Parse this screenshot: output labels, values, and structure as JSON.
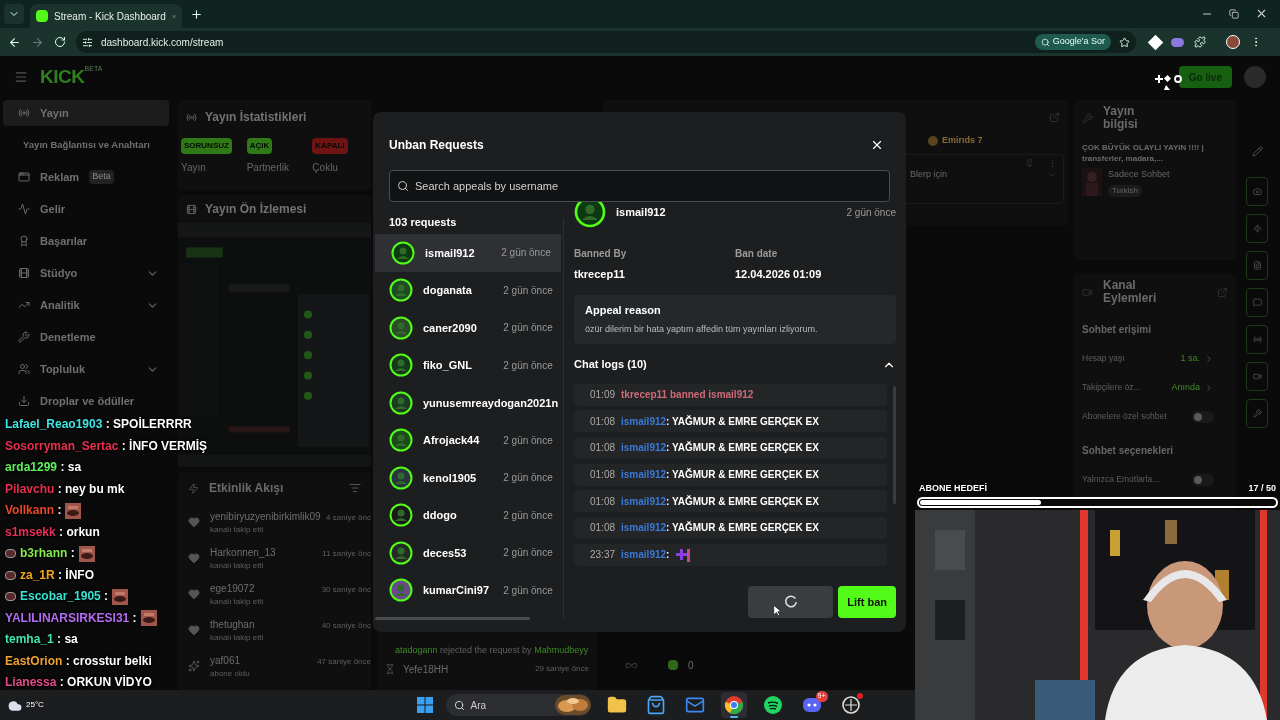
{
  "browser": {
    "tab_title": "Stream - Kick Dashboard",
    "url": "dashboard.kick.com/stream",
    "ask_google": "Google'a Sor"
  },
  "header": {
    "logo": "KICK",
    "logo_badge": "BETA",
    "go_live": "Go live"
  },
  "sidebar": [
    {
      "label": "Yayın",
      "kind": "item",
      "selected": true,
      "expandable": false
    },
    {
      "label": "Yayın Bağlantısı ve Anahtarı",
      "kind": "sub",
      "selected": false,
      "expandable": false
    },
    {
      "label": "Reklam",
      "badge": "Beta",
      "kind": "item",
      "selected": false,
      "expandable": false
    },
    {
      "label": "Gelir",
      "kind": "item",
      "selected": false,
      "expandable": false
    },
    {
      "label": "Başarılar",
      "kind": "item",
      "selected": false,
      "expandable": false
    },
    {
      "label": "Stüdyo",
      "kind": "item",
      "selected": false,
      "expandable": true
    },
    {
      "label": "Analitik",
      "kind": "item",
      "selected": false,
      "expandable": true
    },
    {
      "label": "Denetleme",
      "kind": "item",
      "selected": false,
      "expandable": false
    },
    {
      "label": "Topluluk",
      "kind": "item",
      "selected": false,
      "expandable": true
    },
    {
      "label": "Droplar ve ödüller",
      "kind": "item",
      "selected": false,
      "expandable": false
    }
  ],
  "stats": {
    "title": "Yayın İstatistikleri",
    "items": [
      {
        "status": "SORUNSUZ",
        "label": "Yayın",
        "color": "#2f7a16"
      },
      {
        "status": "AÇIK",
        "label": "Partnerlik",
        "color": "#2f7a16"
      },
      {
        "status": "KAPALI",
        "label": "Çoklu",
        "color": "#6e1414"
      }
    ]
  },
  "preview": {
    "title": "Yayın Ön İzlemesi"
  },
  "activity": {
    "title": "Etkinlik Akışı",
    "events": [
      {
        "kind": "follow",
        "user": "yenibiryuzyenibirkimlik09",
        "time": "4 saniye önc",
        "action": "kanalı takip etti"
      },
      {
        "kind": "follow",
        "user": "Harkonnen_13",
        "time": "11 saniye önc",
        "action": "kanalı takip etti"
      },
      {
        "kind": "follow",
        "user": "ege19072",
        "time": "30 saniye önc",
        "action": "kanalı takip etti"
      },
      {
        "kind": "follow",
        "user": "thetughan",
        "time": "40 saniye önc",
        "action": "kanalı takip etti"
      },
      {
        "kind": "subscribe",
        "user": "yaf061",
        "time": "47 saniye önce",
        "action": "abone oldu"
      }
    ]
  },
  "mod_log": [
    {
      "kind": "rejected",
      "actor": "atadogann",
      "text": "rejected the request by",
      "target": "Mahmudbeyy"
    },
    {
      "kind": "timeout",
      "user": "Yefe18HH",
      "time": "29 saniye önce"
    }
  ],
  "chat_panel": {
    "points": "Emirıds 7",
    "card": "Blerp için",
    "count": "0"
  },
  "stream_info": {
    "title": "Yayın bilgisi",
    "stream_title": "ÇOK BÜYÜK OLAYLI YAYIN !!!! | transferler, madara,...",
    "category": "Sadece Sohbet",
    "language": "Turkish"
  },
  "channel_actions": {
    "title": "Kanal Eylemleri",
    "sections": [
      {
        "heading": "Sohbet erişimi",
        "rows": [
          {
            "kind": "link",
            "label": "Hesap yaşı",
            "value": "1 sa."
          },
          {
            "kind": "link",
            "label": "Takipçilere öz...",
            "value": "Anında"
          },
          {
            "kind": "toggle",
            "label": "Abonelere özel sohbet",
            "on": false
          }
        ]
      },
      {
        "heading": "Sohbet seçenekleri",
        "rows": [
          {
            "kind": "toggle",
            "label": "Yalnızca Emotlarla...",
            "on": false
          }
        ]
      }
    ]
  },
  "unban_modal": {
    "title": "Unban Requests",
    "search_placeholder": "Search appeals by username",
    "count": "103 requests",
    "requests": [
      {
        "user": "ismail912",
        "time": "2 gün önce",
        "selected": true
      },
      {
        "user": "doganata",
        "time": "2 gün önce",
        "selected": false
      },
      {
        "user": "caner2090",
        "time": "2 gün önce",
        "selected": false
      },
      {
        "user": "fiko_GNL",
        "time": "2 gün önce",
        "selected": false
      },
      {
        "user": "yunusemreaydogan2021n",
        "selected": false
      },
      {
        "user": "Afrojack44",
        "time": "2 gün önce",
        "selected": false
      },
      {
        "user": "kenol1905",
        "time": "2 gün önce",
        "selected": false
      },
      {
        "user": "ddogo",
        "time": "2 gün önce",
        "selected": false
      },
      {
        "user": "deces53",
        "time": "2 gün önce",
        "selected": false
      },
      {
        "user": "kumarCini97",
        "time": "2 gün önce",
        "selected": false
      }
    ],
    "detail": {
      "user": "ismail912",
      "time": "2 gün önce",
      "banned_by_label": "Banned By",
      "banned_by": "tkrecep11",
      "ban_date_label": "Ban date",
      "ban_date": "12.04.2026 01:09",
      "appeal_title": "Appeal reason",
      "appeal_text": "özür dilerim bir hata yaptım affedin tüm yayınları izliyorum.",
      "logs_title": "Chat logs (10)",
      "logs_expanded": true,
      "logs": [
        {
          "kind": "ban",
          "time": "01:09",
          "text": "tkrecep11 banned ismail912"
        },
        {
          "kind": "message",
          "time": "01:08",
          "user": "ismail912",
          "text": ": YAĞMUR & EMRE GERÇEK EX"
        },
        {
          "kind": "message",
          "time": "01:08",
          "user": "ismail912",
          "text": ": YAĞMUR & EMRE GERÇEK EX"
        },
        {
          "kind": "message",
          "time": "01:08",
          "user": "ismail912",
          "text": ": YAĞMUR & EMRE GERÇEK EX"
        },
        {
          "kind": "message",
          "time": "01:08",
          "user": "ismail912",
          "text": ": YAĞMUR & EMRE GERÇEK EX"
        },
        {
          "kind": "message",
          "time": "01:08",
          "user": "ismail912",
          "text": ": YAĞMUR & EMRE GERÇEK EX"
        },
        {
          "kind": "emote",
          "time": "23:37",
          "user": "ismail912",
          "text": ":"
        }
      ]
    },
    "loading": true,
    "lift_ban": "Lift ban"
  },
  "overlay_chat": [
    {
      "kind": "text",
      "user": "Lafael_Reao1903",
      "color": "#3ee6e6",
      "badge": false,
      "message": ": SPOİLERRRR"
    },
    {
      "kind": "text",
      "user": "Sosorryman_Sertac",
      "color": "#e8304e",
      "badge": false,
      "message": ": İNFO VERMİŞ"
    },
    {
      "kind": "text",
      "user": "arda1299",
      "color": "#5cf25c",
      "badge": false,
      "message": ": sa"
    },
    {
      "kind": "text",
      "user": "Pilavchu",
      "color": "#e8304e",
      "badge": false,
      "message": ": ney bu mk"
    },
    {
      "kind": "emote",
      "user": "Vollkann",
      "color": "#ea4a2a",
      "badge": false,
      "message": ":"
    },
    {
      "kind": "text",
      "user": "s1msekk",
      "color": "#e8305a",
      "badge": false,
      "message": ": orkun"
    },
    {
      "kind": "emote",
      "user": "b3rhann",
      "color": "#86ec4c",
      "badge": true,
      "message": ":"
    },
    {
      "kind": "text",
      "user": "za_1R",
      "color": "#f2a622",
      "badge": true,
      "message": ": İNFO"
    },
    {
      "kind": "emote",
      "user": "Escobar_1905",
      "color": "#36e2d2",
      "badge": true,
      "message": ":"
    },
    {
      "kind": "emote",
      "user": "YALILINARSIRKESI31",
      "color": "#b46cf2",
      "badge": false,
      "message": ":"
    },
    {
      "kind": "text",
      "user": "temha_1",
      "color": "#42e6b4",
      "badge": false,
      "message": ": sa"
    },
    {
      "kind": "text",
      "user": "EastOrion",
      "color": "#f2a230",
      "badge": false,
      "message": ": crosstur belki"
    },
    {
      "kind": "text",
      "user": "Lianessa",
      "color": "#e64a8a",
      "badge": false,
      "message": ": ORKUN VİDYO"
    }
  ],
  "sub_goal": {
    "label": "ABONE HEDEFİ",
    "count": "17 / 50",
    "level": 0.34
  },
  "taskbar": {
    "weather": "25°C",
    "search": "Ara",
    "apps": [
      {
        "kind": "explorer",
        "active": false,
        "alert": false
      },
      {
        "kind": "store",
        "active": false,
        "alert": false
      },
      {
        "kind": "mail",
        "active": false,
        "alert": false
      },
      {
        "kind": "chrome",
        "active": true,
        "alert": false
      },
      {
        "kind": "spotify",
        "active": false,
        "alert": false
      },
      {
        "kind": "discord",
        "active": false,
        "alert": false,
        "badge": "9+"
      },
      {
        "kind": "app",
        "active": false,
        "alert": true
      }
    ]
  }
}
